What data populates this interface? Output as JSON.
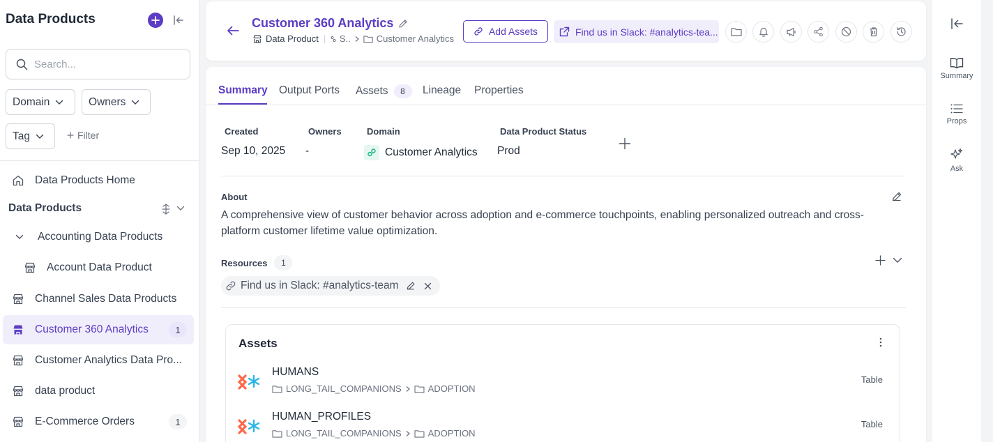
{
  "sidebar": {
    "title": "Data Products",
    "search_placeholder": "Search...",
    "filters": {
      "domain": "Domain",
      "owners": "Owners",
      "tag": "Tag",
      "add_filter": "Filter"
    },
    "home": "Data Products Home",
    "section": "Data Products",
    "items": [
      {
        "label": "Accounting Data Products",
        "count": ""
      },
      {
        "label": "Account Data Product",
        "count": ""
      },
      {
        "label": "Channel Sales Data Products",
        "count": ""
      },
      {
        "label": "Customer 360 Analytics",
        "count": "1"
      },
      {
        "label": "Customer Analytics Data Pro...",
        "count": ""
      },
      {
        "label": "data product",
        "count": ""
      },
      {
        "label": "E-Commerce Orders",
        "count": "1"
      }
    ]
  },
  "header": {
    "title": "Customer 360 Analytics",
    "entity_type": "Data Product",
    "bc_short": "S..",
    "bc_domain": "Customer Analytics",
    "add_assets": "Add Assets",
    "slack_link": "Find us in Slack: #analytics-tea..."
  },
  "tabs": [
    {
      "label": "Summary"
    },
    {
      "label": "Output Ports"
    },
    {
      "label": "Assets",
      "badge": "8"
    },
    {
      "label": "Lineage"
    },
    {
      "label": "Properties"
    }
  ],
  "meta": {
    "created_label": "Created",
    "created_value": "Sep 10, 2025",
    "owners_label": "Owners",
    "owners_value": "-",
    "domain_label": "Domain",
    "domain_value": "Customer Analytics",
    "status_label": "Data Product Status",
    "status_value": "Prod"
  },
  "about": {
    "label": "About",
    "text": "A comprehensive view of customer behavior across adoption and e-commerce touchpoints, enabling personalized outreach and cross-platform customer lifetime value optimization."
  },
  "resources": {
    "label": "Resources",
    "count": "1",
    "link": "Find us in Slack: #analytics-team"
  },
  "assets": {
    "title": "Assets",
    "rows": [
      {
        "name": "HUMANS",
        "db": "LONG_TAIL_COMPANIONS",
        "schema": "ADOPTION",
        "type": "Table"
      },
      {
        "name": "HUMAN_PROFILES",
        "db": "LONG_TAIL_COMPANIONS",
        "schema": "ADOPTION",
        "type": "Table"
      }
    ]
  },
  "right_panel": {
    "summary": "Summary",
    "props": "Props",
    "ask": "Ask"
  },
  "colors": {
    "accent": "#5b3cc4",
    "accent_light": "#f1eefc",
    "domain_green": "#10b981"
  }
}
